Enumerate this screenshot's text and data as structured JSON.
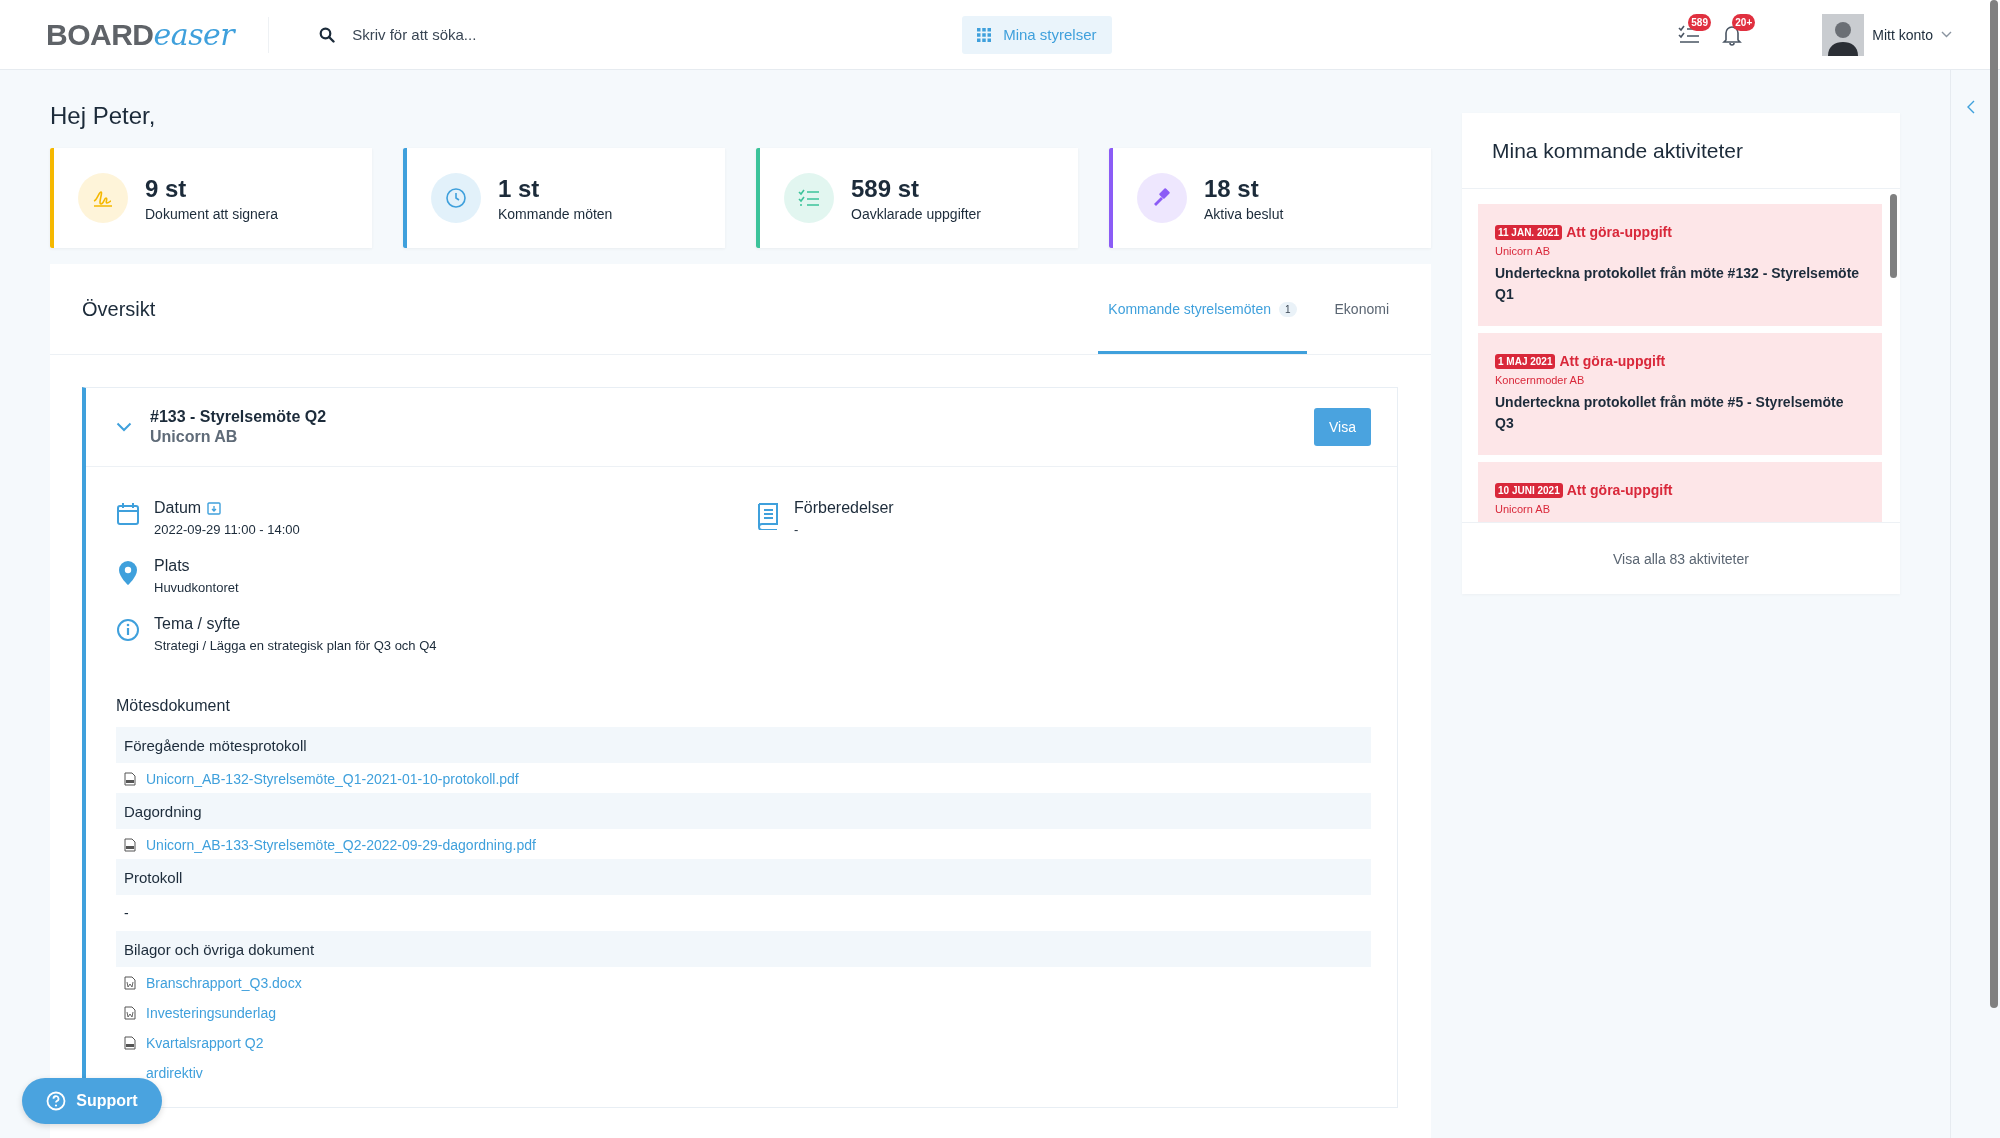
{
  "header": {
    "logo_bold": "BOARD",
    "logo_script": "easer",
    "search": {
      "placeholder": "Skriv för att söka..."
    },
    "boards_button": "Mina styrelser",
    "tasks_badge": "589",
    "notifications_badge": "20+",
    "account": "Mitt konto"
  },
  "greeting": "Hej Peter,",
  "stats": [
    {
      "value": "9 st",
      "label": "Dokument att signera",
      "color": "#f5b800"
    },
    {
      "value": "1 st",
      "label": "Kommande möten",
      "color": "#3fa0dc"
    },
    {
      "value": "589 st",
      "label": "Oavklarade uppgifter",
      "color": "#3cc39a"
    },
    {
      "value": "18 st",
      "label": "Aktiva beslut",
      "color": "#8b5cf6"
    }
  ],
  "overview": {
    "title": "Översikt",
    "tabs": [
      {
        "label": "Kommande styrelsemöten",
        "badge": "1",
        "selected": true
      },
      {
        "label": "Ekonomi",
        "selected": false
      }
    ],
    "meeting": {
      "title": "#133 - Styrelsemöte Q2",
      "company": "Unicorn AB",
      "expanded": true,
      "button": "Visa",
      "details_left": [
        {
          "kind": "date",
          "label": "Datum",
          "value": "2022-09-29 11:00 - 14:00"
        },
        {
          "kind": "place",
          "label": "Plats",
          "value": "Huvudkontoret"
        },
        {
          "kind": "info",
          "label": "Tema / syfte",
          "value": "Strategi / Lägga en strategisk plan för Q3 och Q4"
        }
      ],
      "details_right": [
        {
          "kind": "book",
          "label": "Förberedelser",
          "value": "-"
        }
      ],
      "documents_title": "Mötesdokument",
      "sections": [
        {
          "title": "Föregående mötesprotokoll",
          "docs": [
            {
              "name": "Unicorn_AB-132-Styrelsemöte_Q1-2021-01-10-protokoll.pdf",
              "kind": "pdf"
            }
          ]
        },
        {
          "title": "Dagordning",
          "docs": [
            {
              "name": "Unicorn_AB-133-Styrelsemöte_Q2-2022-09-29-dagordning.pdf",
              "kind": "pdf"
            }
          ]
        },
        {
          "title": "Protokoll",
          "note": "-"
        },
        {
          "title": "Bilagor och övriga dokument",
          "docs": [
            {
              "name": "Branschrapport_Q3.docx",
              "kind": "word"
            },
            {
              "name": "Investeringsunderlag",
              "kind": "word"
            },
            {
              "name": "Kvartalsrapport Q2",
              "kind": "pdf"
            },
            {
              "name": "ardirektiv"
            }
          ]
        }
      ]
    }
  },
  "activities": {
    "title": "Mina kommande aktiviteter",
    "items": [
      {
        "date": "11 JAN. 2021",
        "type": "Att göra-uppgift",
        "company": "Unicorn AB",
        "text": "Underteckna protokollet från möte #132 - Styrelsemöte Q1"
      },
      {
        "date": "1 MAJ 2021",
        "type": "Att göra-uppgift",
        "company": "Koncernmoder AB",
        "text": "Underteckna protokollet från möte #5 - Styrelsemöte Q3"
      },
      {
        "date": "10 JUNI 2021",
        "type": "Att göra-uppgift",
        "company": "Unicorn AB"
      }
    ],
    "footer": "Visa alla 83 aktiviteter"
  },
  "support_button": "Support"
}
